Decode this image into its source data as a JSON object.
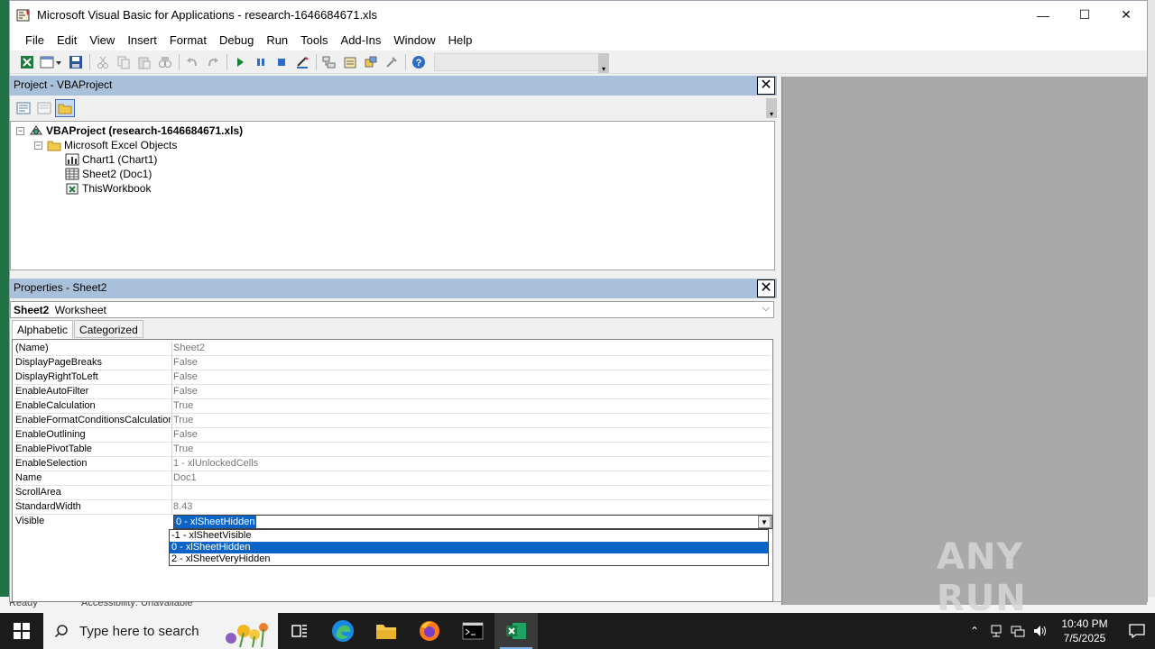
{
  "window": {
    "title": "Microsoft Visual Basic for Applications - research-1646684671.xls",
    "minimize": "—",
    "maximize": "☐",
    "close": "✕"
  },
  "menu": [
    "File",
    "Edit",
    "View",
    "Insert",
    "Format",
    "Debug",
    "Run",
    "Tools",
    "Add-Ins",
    "Window",
    "Help"
  ],
  "toolbar_icons": [
    "view-excel-icon",
    "insert-userform-icon",
    "save-icon",
    "cut-icon",
    "copy-icon",
    "paste-icon",
    "find-icon",
    "undo-icon",
    "redo-icon",
    "run-icon",
    "break-icon",
    "reset-icon",
    "design-mode-icon",
    "project-explorer-icon",
    "properties-window-icon",
    "object-browser-icon",
    "toolbox-icon",
    "help-icon"
  ],
  "project_pane": {
    "title": "Project - VBAProject",
    "close": "✕",
    "tree": {
      "root": "VBAProject (research-1646684671.xls)",
      "folder": "Microsoft Excel Objects",
      "items": [
        "Chart1 (Chart1)",
        "Sheet2 (Doc1)",
        "ThisWorkbook"
      ],
      "expander": "−"
    }
  },
  "properties_pane": {
    "title": "Properties - Sheet2",
    "close": "✕",
    "object_name": "Sheet2",
    "object_type": "Worksheet",
    "combo_arrow": "⌵",
    "tabs": [
      "Alphabetic",
      "Categorized"
    ],
    "rows": [
      {
        "name": "(Name)",
        "value": "Sheet2"
      },
      {
        "name": "DisplayPageBreaks",
        "value": "False"
      },
      {
        "name": "DisplayRightToLeft",
        "value": "False"
      },
      {
        "name": "EnableAutoFilter",
        "value": "False"
      },
      {
        "name": "EnableCalculation",
        "value": "True"
      },
      {
        "name": "EnableFormatConditionsCalculation",
        "value": "True"
      },
      {
        "name": "EnableOutlining",
        "value": "False"
      },
      {
        "name": "EnablePivotTable",
        "value": "True"
      },
      {
        "name": "EnableSelection",
        "value": "1 - xlUnlockedCells"
      },
      {
        "name": "Name",
        "value": "Doc1"
      },
      {
        "name": "ScrollArea",
        "value": ""
      },
      {
        "name": "StandardWidth",
        "value": "8.43"
      },
      {
        "name": "Visible",
        "value": "0 - xlSheetHidden"
      }
    ],
    "dropdown_arrow": "▼",
    "visible_options": [
      "-1 - xlSheetVisible",
      "0 - xlSheetHidden",
      "2 - xlSheetVeryHidden"
    ],
    "visible_selected_index": 1
  },
  "status_bar": {
    "left": "Ready",
    "accessibility": "Accessibility: Unavailable"
  },
  "watermark": "ANY RUN",
  "taskbar": {
    "search_placeholder": "Type here to search",
    "apps": [
      "task-view-icon",
      "edge-icon",
      "file-explorer-icon",
      "firefox-icon",
      "terminal-icon",
      "excel-icon"
    ],
    "active_app": "excel-icon",
    "time": "10:40 PM",
    "date": "7/5/2025",
    "tray_icons": [
      "chevron-up-icon",
      "network-alt-icon",
      "network-icon",
      "volume-icon",
      "notification-icon"
    ]
  },
  "colors": {
    "pane_title_bg": "#a9c0da",
    "selection": "#0a64c8",
    "mdi_bg": "#a9a9a9",
    "excel_green": "#217346",
    "taskbar_bg": "#1c1c1c"
  }
}
